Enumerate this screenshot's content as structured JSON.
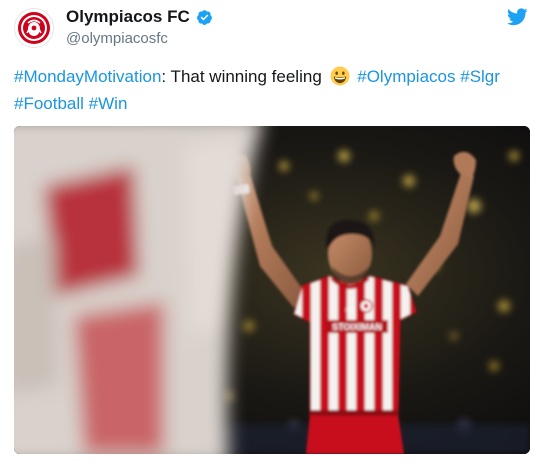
{
  "author": {
    "display_name": "Olympiacos FC",
    "handle": "@olympiacosfc",
    "verified": true,
    "avatar_icon": "olympiacos-crest-icon"
  },
  "tweet": {
    "segments": [
      {
        "type": "hashtag",
        "text": "#MondayMotivation"
      },
      {
        "type": "text",
        "text": ": That winning feeling "
      },
      {
        "type": "emoji",
        "text": "grinning-face-icon"
      },
      {
        "type": "text",
        "text": " "
      },
      {
        "type": "hashtag",
        "text": "#Olympiacos"
      },
      {
        "type": "text",
        "text": " "
      },
      {
        "type": "hashtag",
        "text": "#Slgr"
      },
      {
        "type": "text",
        "text": " "
      },
      {
        "type": "hashtag",
        "text": "#Football"
      },
      {
        "type": "text",
        "text": " "
      },
      {
        "type": "hashtag",
        "text": "#Win"
      }
    ]
  },
  "media": {
    "kind": "photo",
    "shirt_sponsor": "STOIXIMAN",
    "shirt_badge": "GR"
  },
  "colors": {
    "text": "#14171a",
    "muted": "#657786",
    "link": "#1b95e0",
    "twitter_blue": "#1da1f2",
    "club_red": "#d0021b"
  },
  "icons": {
    "verified": "verified-badge-icon",
    "platform": "twitter-bird-icon"
  }
}
